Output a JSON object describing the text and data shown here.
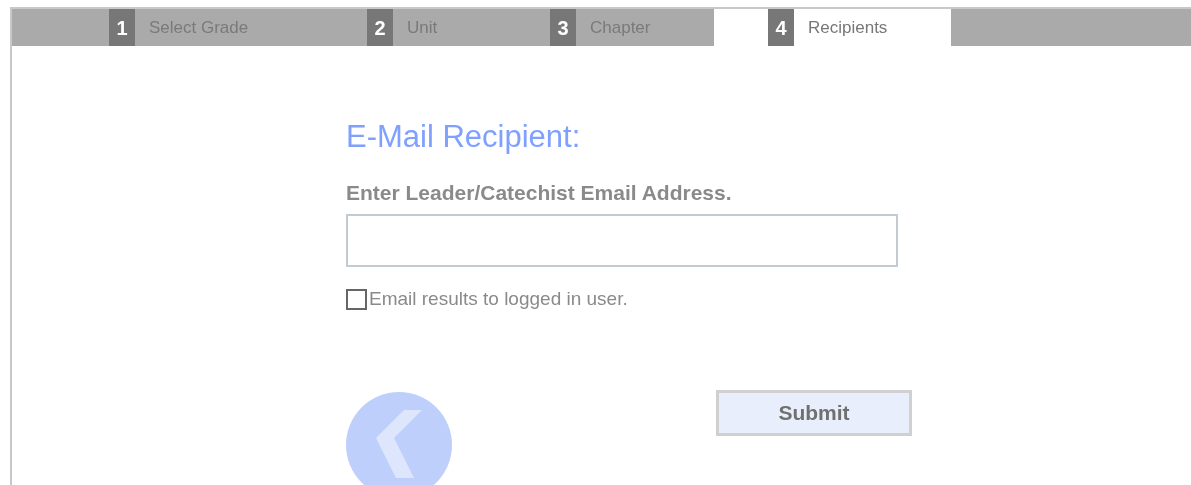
{
  "tabs": [
    {
      "number": "1",
      "label": "Select Grade",
      "selected": false
    },
    {
      "number": "2",
      "label": "Unit",
      "selected": false
    },
    {
      "number": "3",
      "label": "Chapter",
      "selected": false
    },
    {
      "number": "4",
      "label": "Recipients",
      "selected": true
    }
  ],
  "heading": "E-Mail Recipient:",
  "email_field": {
    "label": "Enter Leader/Catechist Email Address."
  },
  "email_self": {
    "label": "Email results to logged in user.",
    "checked": false
  },
  "submit_button": "Submit"
}
